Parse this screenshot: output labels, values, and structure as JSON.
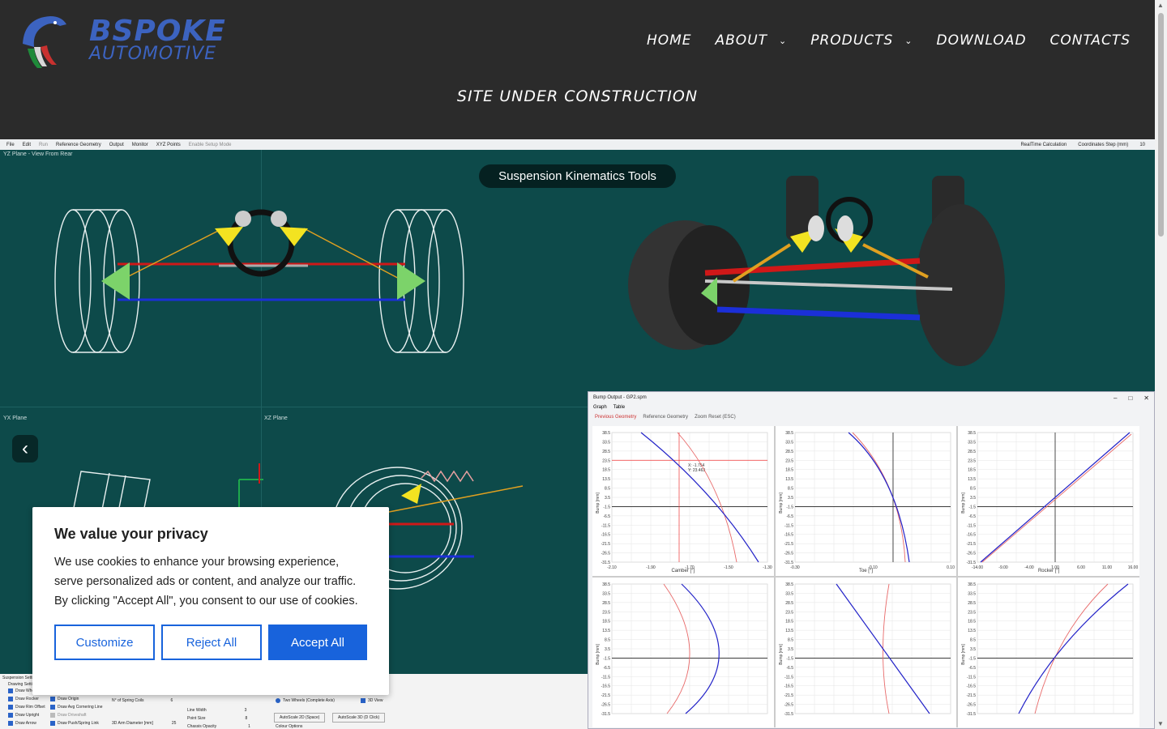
{
  "brand": {
    "line1": "BSPOKE",
    "line2": "AUTOMOTIVE"
  },
  "nav": [
    {
      "label": "HOME",
      "dropdown": false
    },
    {
      "label": "ABOUT",
      "dropdown": true
    },
    {
      "label": "PRODUCTS",
      "dropdown": true
    },
    {
      "label": "DOWNLOAD",
      "dropdown": false
    },
    {
      "label": "CONTACTS",
      "dropdown": false
    }
  ],
  "banner": "SITE UNDER CONSTRUCTION",
  "slider": {
    "caption": "Suspension Kinematics Tools",
    "prev": "‹",
    "next": "›"
  },
  "app": {
    "toolbar": [
      "File",
      "Edit",
      "Run",
      "Reference Geometry",
      "Output",
      "Monitor",
      "XYZ Points",
      "Enable Setup Mode"
    ],
    "toolbar_right": [
      "RealTime Calculation",
      "Coordinates Step (mm)",
      "10"
    ],
    "pane_yz": "YZ Plane - View From Rear",
    "pane_yx": "YX Plane",
    "pane_xz": "XZ Plane",
    "graph_title": "Bump Output - GP2.spm",
    "graph_tabs": [
      "Graph",
      "Table"
    ],
    "graph_opts": [
      "Previous Geometry",
      "Reference Geometry",
      "Zoom Reset (ESC)"
    ],
    "ylabel": "Bump [mm]",
    "yticks": [
      "38.5",
      "33.5",
      "28.5",
      "23.5",
      "18.5",
      "13.5",
      "8.5",
      "3.5",
      "-1.5",
      "-6.5",
      "-11.5",
      "-16.5",
      "-21.5",
      "-26.5",
      "-31.5"
    ],
    "plots": [
      {
        "xlabel": "Camber [°]",
        "xticks": [
          "-2.10",
          "-1.90",
          "-1.70",
          "-1.50",
          "-1.30"
        ],
        "cursor": [
          "X: -1.754",
          "Y: 23.463"
        ]
      },
      {
        "xlabel": "Toe [°]",
        "xticks": [
          "-0.30",
          "-0.10",
          "0.10"
        ]
      },
      {
        "xlabel": "Rocker [°]",
        "xticks": [
          "-14.00",
          "-9.00",
          "-4.00",
          "1.00",
          "6.00",
          "11.00",
          "16.00"
        ]
      },
      {
        "xlabel": ""
      },
      {
        "xlabel": ""
      },
      {
        "xlabel": ""
      }
    ],
    "bottom": {
      "tab": "Suspension Settings",
      "section": "Drawing Settings",
      "checks_left": [
        "Draw Wheel",
        "Draw Rocker",
        "Draw Rim Offset",
        "Draw Upright",
        "Draw Arrow"
      ],
      "checks_mid": [
        "Draw Origin",
        "Draw Avg Cornering Line",
        "Draw Driveshaft",
        "Draw Push/Spring Link"
      ],
      "spring_coils": "N° of Spring Coils",
      "spring_coils_val": "6",
      "arm_diam": "3D Arm Diameter [mm]",
      "arm_diam_val": "25",
      "line_width": "Line Width",
      "line_width_val": "3",
      "point_size": "Point Size",
      "point_size_val": "8",
      "chassis": "Chassis Opacity",
      "chassis_val": "1",
      "two_wheels": "Two Wheels (Complete Axis)",
      "view3d": "3D View",
      "autoscale2d": "AutoScale 2D (Space)",
      "autoscale3d": "AutoScale 3D (D Click)",
      "colour": "Colour Options"
    }
  },
  "cookie": {
    "title": "We value your privacy",
    "body": "We use cookies to enhance your browsing experience, serve personalized ads or content, and analyze our traffic. By clicking \"Accept All\", you consent to our use of cookies.",
    "customize": "Customize",
    "reject": "Reject All",
    "accept": "Accept All"
  },
  "colors": {
    "header": "#2b2b2b",
    "brand": "#3c63c0",
    "viewport": "#0d4a4a",
    "accent": "#1863dc"
  }
}
